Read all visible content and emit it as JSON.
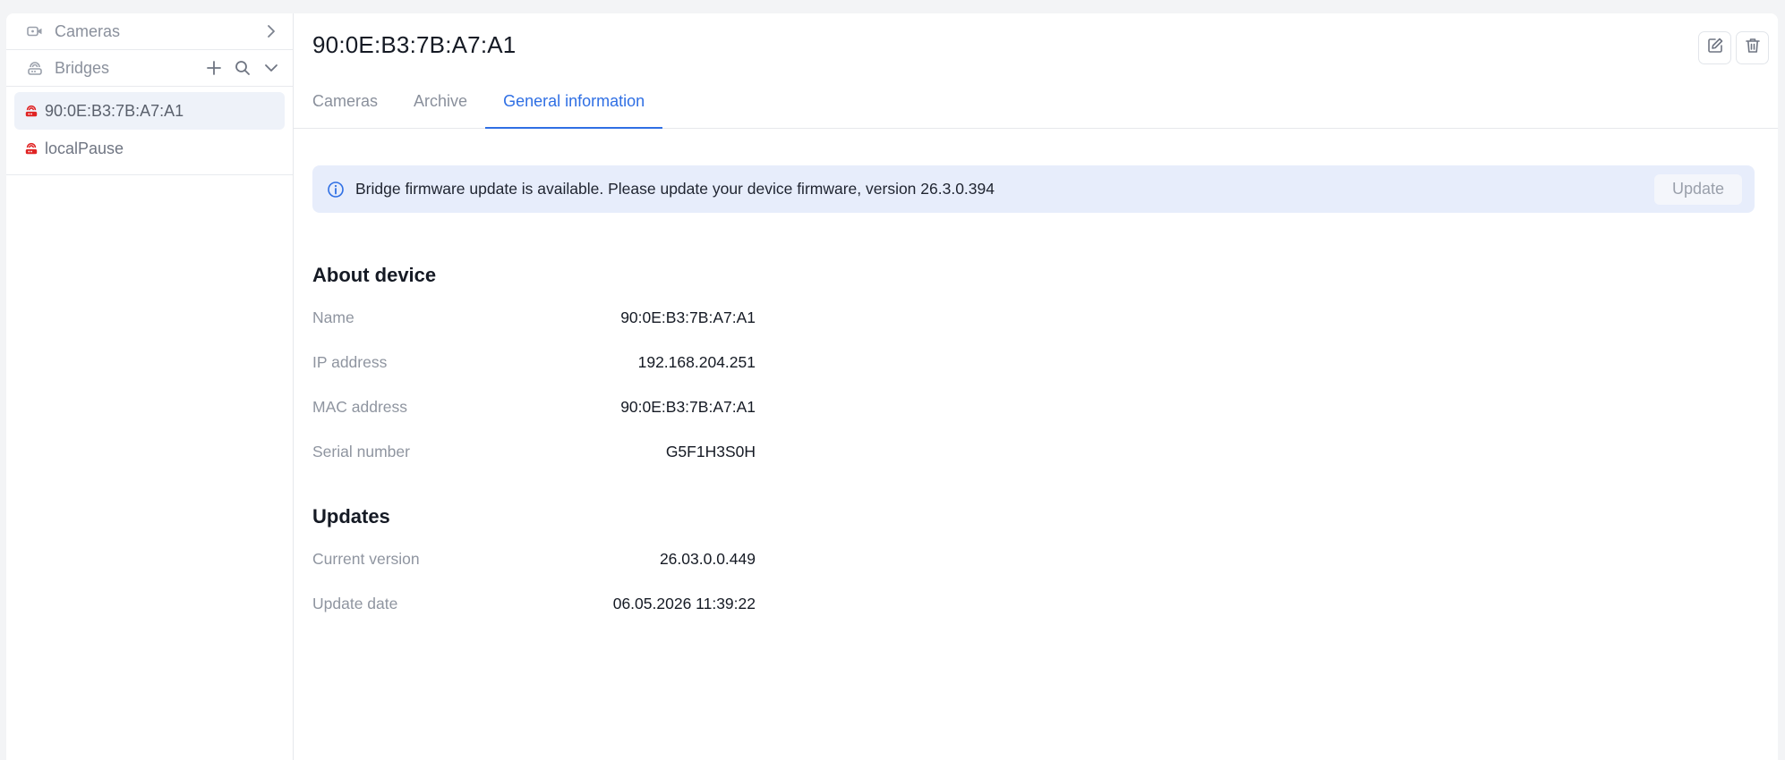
{
  "sidebar": {
    "cameras_label": "Cameras",
    "bridges_label": "Bridges",
    "bridges": [
      {
        "label": "90:0E:B3:7B:A7:A1",
        "active": true
      },
      {
        "label": "localPause",
        "active": false
      }
    ]
  },
  "header": {
    "title": "90:0E:B3:7B:A7:A1",
    "tabs": [
      {
        "label": "Cameras"
      },
      {
        "label": "Archive"
      },
      {
        "label": "General information"
      }
    ]
  },
  "banner": {
    "message": "Bridge firmware update is available. Please update your device firmware, version 26.3.0.394",
    "button_label": "Update"
  },
  "about": {
    "title": "About device",
    "rows": [
      {
        "label": "Name",
        "value": "90:0E:B3:7B:A7:A1"
      },
      {
        "label": "IP address",
        "value": "192.168.204.251"
      },
      {
        "label": "MAC address",
        "value": "90:0E:B3:7B:A7:A1"
      },
      {
        "label": "Serial number",
        "value": "G5F1H3S0H"
      }
    ]
  },
  "updates": {
    "title": "Updates",
    "rows": [
      {
        "label": "Current version",
        "value": "26.03.0.0.449"
      },
      {
        "label": "Update date",
        "value": "06.05.2026 11:39:22"
      }
    ]
  },
  "colors": {
    "accent": "#2f6fe4",
    "bridge_status": "#e02424",
    "banner_bg": "#e7edfb"
  },
  "icons": [
    "camera-icon",
    "chevron-right-icon",
    "bridge-icon",
    "plus-icon",
    "search-icon",
    "chevron-down-icon",
    "edit-icon",
    "trash-icon",
    "info-icon"
  ]
}
